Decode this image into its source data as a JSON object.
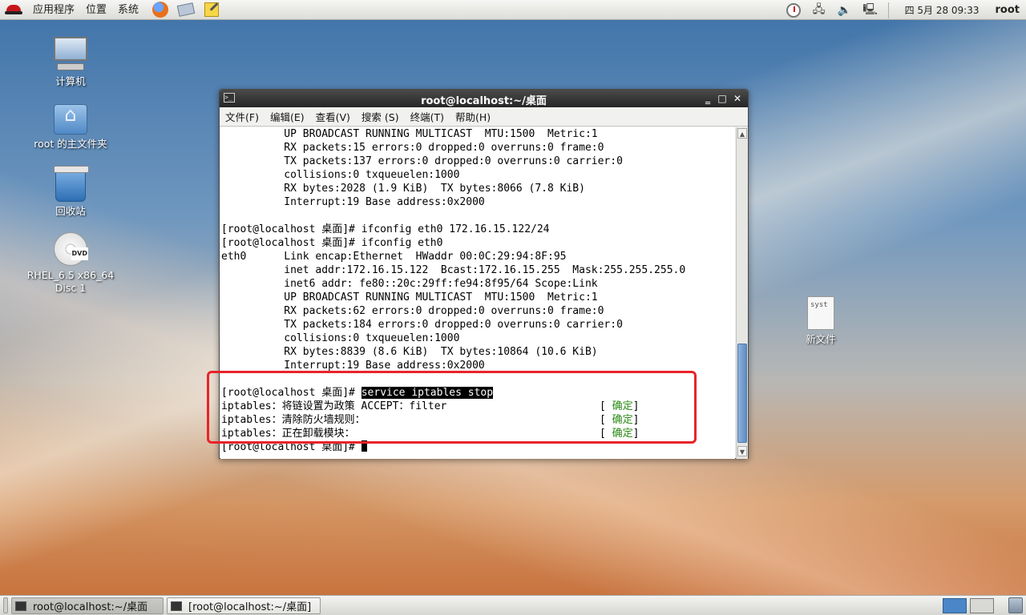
{
  "top_panel": {
    "menus": [
      "应用程序",
      "位置",
      "系统"
    ],
    "launchers": [
      "firefox-icon",
      "mail-icon",
      "notes-icon"
    ],
    "clock": "四 5月 28 09:33",
    "user": "root",
    "tray_icons": [
      "updater-icon",
      "network-icon",
      "volume-icon",
      "display-icon"
    ]
  },
  "desktop": {
    "icons": [
      {
        "name": "computer-icon",
        "label": "计算机"
      },
      {
        "name": "home-folder-icon",
        "label": "root 的主文件夹"
      },
      {
        "name": "trash-icon",
        "label": "回收站"
      },
      {
        "name": "dvd-icon",
        "label_line1": "RHEL_6.5 x86_64",
        "label_line2": "Disc 1",
        "badge": "DVD"
      },
      {
        "name": "file-icon",
        "label": "新文件",
        "preview": "syst"
      }
    ]
  },
  "terminal": {
    "title": "root@localhost:~/桌面",
    "menu": [
      "文件(F)",
      "编辑(E)",
      "查看(V)",
      "搜索 (S)",
      "终端(T)",
      "帮助(H)"
    ],
    "lines": [
      "          UP BROADCAST RUNNING MULTICAST  MTU:1500  Metric:1",
      "          RX packets:15 errors:0 dropped:0 overruns:0 frame:0",
      "          TX packets:137 errors:0 dropped:0 overruns:0 carrier:0",
      "          collisions:0 txqueuelen:1000",
      "          RX bytes:2028 (1.9 KiB)  TX bytes:8066 (7.8 KiB)",
      "          Interrupt:19 Base address:0x2000",
      "",
      "[root@localhost 桌面]# ifconfig eth0 172.16.15.122/24",
      "[root@localhost 桌面]# ifconfig eth0",
      "eth0      Link encap:Ethernet  HWaddr 00:0C:29:94:8F:95",
      "          inet addr:172.16.15.122  Bcast:172.16.15.255  Mask:255.255.255.0",
      "          inet6 addr: fe80::20c:29ff:fe94:8f95/64 Scope:Link",
      "          UP BROADCAST RUNNING MULTICAST  MTU:1500  Metric:1",
      "          RX packets:62 errors:0 dropped:0 overruns:0 frame:0",
      "          TX packets:184 errors:0 dropped:0 overruns:0 carrier:0",
      "          collisions:0 txqueuelen:1000",
      "          RX bytes:8839 (8.6 KiB)  TX bytes:10864 (10.6 KiB)",
      "          Interrupt:19 Base address:0x2000",
      ""
    ],
    "command_prompt": "[root@localhost 桌面]# ",
    "command_text": "service iptables stop",
    "results": [
      {
        "text": "iptables：将链设置为政策 ACCEPT：filter",
        "status": "确定"
      },
      {
        "text": "iptables：清除防火墙规则：",
        "status": "确定"
      },
      {
        "text": "iptables：正在卸载模块：",
        "status": "确定"
      }
    ],
    "final_prompt": "[root@localhost 桌面]# "
  },
  "taskbar": {
    "tasks": [
      {
        "label": "root@localhost:~/桌面",
        "active": true
      },
      {
        "label": "[root@localhost:~/桌面]",
        "active": false
      }
    ]
  },
  "colors": {
    "ok_status": "#2a8a14",
    "highlight_box": "#e8232a",
    "title_bar": "#2b2b2b"
  }
}
